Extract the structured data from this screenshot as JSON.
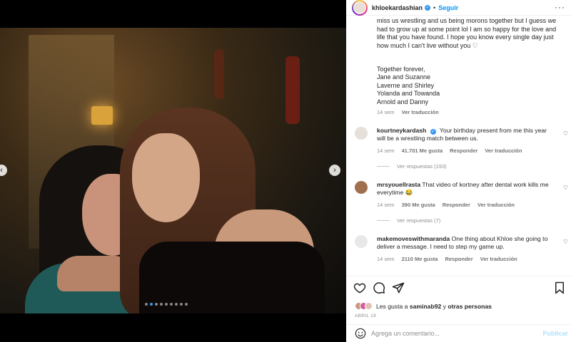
{
  "post": {
    "username": "khloekardashian",
    "separator": "•",
    "follow_label": "Seguir",
    "more_label": "···"
  },
  "caption": {
    "partial_top": "miss us wrestling and us being morons together but I guess we had to grow up at some point lol I am so happy for the love and life that you have found. I hope you know every single day just how much I can't live without you ♡",
    "lines": [
      "Together forever,",
      "Jane and Suzanne",
      "Laverne and Shirley",
      "Yolanda and Towanda",
      "Arnold and Danny"
    ],
    "time": "14 sem",
    "translate": "Ver traducción"
  },
  "comments": [
    {
      "user": "kourtneykardash",
      "verified": true,
      "text": "Your birthday present from me this year will be a wrestling match between us.",
      "time": "14 sem",
      "likes": "41.701 Me gusta",
      "reply": "Responder",
      "translate": "Ver traducción",
      "replies": "Ver respuestas (193)"
    },
    {
      "user": "mrsyouellrasta",
      "verified": false,
      "text": "That video of kortney after dental work kills me everytime 😂",
      "time": "14 sem",
      "likes": "390 Me gusta",
      "reply": "Responder",
      "translate": "Ver traducción",
      "replies": "Ver respuestas (7)"
    },
    {
      "user": "makemoveswithmaranda",
      "verified": false,
      "text": "One thing about Khloe she going to deliver a message. I need to step my game up.",
      "time": "14 sem",
      "likes": "2110 Me gusta",
      "reply": "Responder",
      "translate": "Ver traducción"
    }
  ],
  "likes_bar": {
    "prefix": "Les gusta a",
    "user": "saminab92",
    "middle": "y",
    "others": "otras personas"
  },
  "date": "ABRIL 18",
  "comment_box": {
    "placeholder": "Agrega un comentario...",
    "publish_label": "Publicar"
  },
  "icons": [
    "heart-icon",
    "comment-icon",
    "share-icon",
    "bookmark-icon",
    "emoji-icon",
    "chevron-left-icon",
    "chevron-right-icon"
  ],
  "colors": {
    "accent": "#0095f6",
    "verified": "#3897f0",
    "publish_disabled": "#b2dffc",
    "muted": "#8e8e8e"
  },
  "carousel": {
    "total_slides": 9,
    "active_index": 1
  }
}
